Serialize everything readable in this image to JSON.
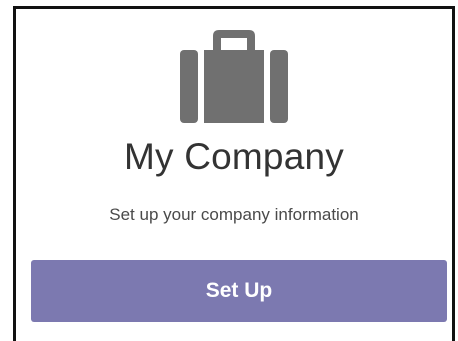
{
  "card": {
    "icon": "briefcase-icon",
    "title": "My Company",
    "subtitle": "Set up your company information",
    "button_label": "Set Up"
  },
  "colors": {
    "icon": "#707070",
    "button_bg": "#7c79b0",
    "button_text": "#ffffff",
    "title_text": "#333333",
    "card_border": "#111111"
  }
}
